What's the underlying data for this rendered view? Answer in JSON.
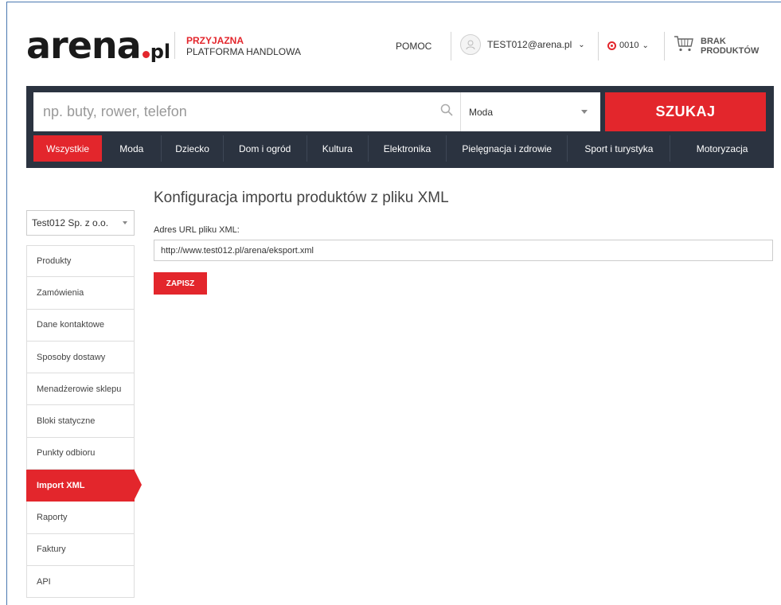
{
  "header": {
    "logo_main": "arena",
    "logo_suffix": "pl",
    "tagline_line1": "PRZYJAZNA",
    "tagline_line2": "PLATFORMA HANDLOWA",
    "help_label": "POMOC",
    "user_email": "TEST012@arena.pl",
    "points_value": "0010",
    "cart_line1": "BRAK",
    "cart_line2": "PRODUKTÓW"
  },
  "search": {
    "placeholder": "np. buty, rower, telefon",
    "category_selected": "Moda",
    "button_label": "SZUKAJ"
  },
  "categories": [
    {
      "label": "Wszystkie",
      "active": true
    },
    {
      "label": "Moda"
    },
    {
      "label": "Dziecko"
    },
    {
      "label": "Dom i ogród"
    },
    {
      "label": "Kultura"
    },
    {
      "label": "Elektronika"
    },
    {
      "label": "Pielęgnacja i zdrowie"
    },
    {
      "label": "Sport i turystyka"
    },
    {
      "label": "Motoryzacja"
    }
  ],
  "sidebar": {
    "shop_selected": "Test012 Sp. z o.o.",
    "items": [
      {
        "label": "Produkty"
      },
      {
        "label": "Zamówienia"
      },
      {
        "label": "Dane kontaktowe"
      },
      {
        "label": "Sposoby dostawy"
      },
      {
        "label": "Menadżerowie sklepu"
      },
      {
        "label": "Bloki statyczne"
      },
      {
        "label": "Punkty odbioru"
      },
      {
        "label": "Import XML",
        "active": true
      },
      {
        "label": "Raporty"
      },
      {
        "label": "Faktury"
      },
      {
        "label": "API"
      }
    ]
  },
  "main": {
    "title": "Konfiguracja importu produktów z pliku XML",
    "url_label": "Adres URL pliku XML:",
    "url_value": "http://www.test012.pl/arena/eksport.xml",
    "save_label": "ZAPISZ"
  },
  "colors": {
    "accent": "#e3262c",
    "nav_bg": "#2b3340"
  }
}
